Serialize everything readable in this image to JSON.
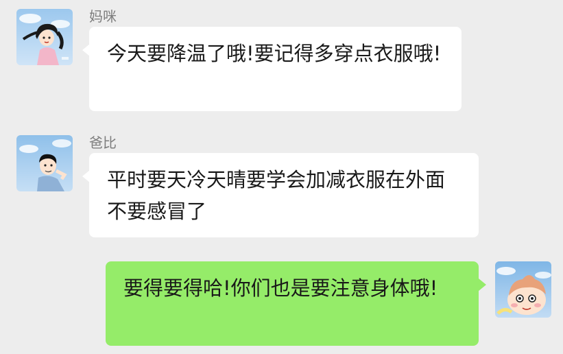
{
  "messages": [
    {
      "sender": "妈咪",
      "direction": "incoming",
      "avatar_icon": "girl-portrait-avatar-icon",
      "text": "今天要降温了哦!要记得多穿点衣服哦!"
    },
    {
      "sender": "爸比",
      "direction": "incoming",
      "avatar_icon": "man-portrait-avatar-icon",
      "text": "平时要天冷天晴要学会加减衣服在外面不要感冒了"
    },
    {
      "sender": "",
      "direction": "outgoing",
      "avatar_icon": "cartoon-boy-avatar-icon",
      "text": "要得要得哈!你们也是要注意身体哦!"
    }
  ],
  "colors": {
    "background": "#ededed",
    "incoming_bubble": "#ffffff",
    "outgoing_bubble": "#95ec69",
    "sender_name": "#7d7d7d",
    "text": "#191919"
  }
}
